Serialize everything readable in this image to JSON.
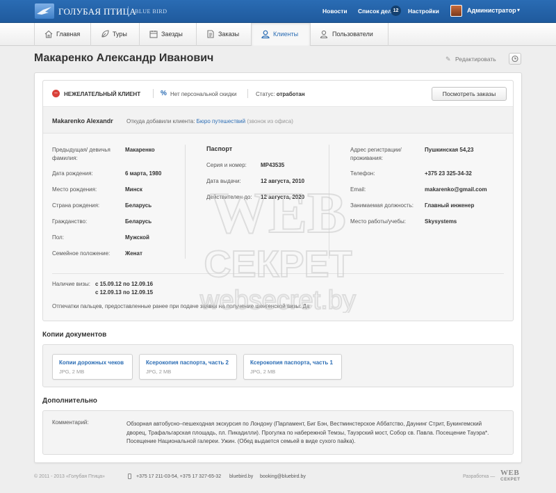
{
  "header": {
    "logo_title": "ГОЛУБАЯ ПТИЦА",
    "logo_sub": "BLUE BIRD",
    "links": [
      "Новости",
      "Список дел",
      "Настройки"
    ],
    "todo_count": "12",
    "user_name": "Администратор",
    "user_caret": "▾"
  },
  "nav": {
    "tabs": [
      {
        "label": "Главная",
        "icon": "home-icon"
      },
      {
        "label": "Туры",
        "icon": "leaf-icon"
      },
      {
        "label": "Заезды",
        "icon": "calendar-icon"
      },
      {
        "label": "Заказы",
        "icon": "document-icon"
      },
      {
        "label": "Клиенты",
        "icon": "user-icon",
        "active": true
      },
      {
        "label": "Пользователи",
        "icon": "users-icon"
      }
    ]
  },
  "page": {
    "title": "Макаренко Александр Иванович",
    "edit_label": "Редактировать"
  },
  "client": {
    "bad_client_label": "НЕЖЕЛАТЕЛЬНЫЙ КЛИЕНТ",
    "discount_label": "Нет персональной скидки",
    "status_label": "Статус:",
    "status_value": "отработан",
    "orders_button": "Посмотреть заказы",
    "latin_name": "Makarenko Alexandr",
    "source_label": "Откуда добавили клиента:",
    "source_value": "Бюро путешествий",
    "source_note": "(звонок из офиса)"
  },
  "personal": {
    "maiden_label": "Предыдущая/ девичья фамилия:",
    "maiden_value": "Макаренко",
    "birth_date_label": "Дата рождения:",
    "birth_date_value": "6 марта, 1980",
    "birth_place_label": "Место рождения:",
    "birth_place_value": "Минск",
    "birth_country_label": "Страна рождения:",
    "birth_country_value": "Беларусь",
    "citizenship_label": "Гражданство:",
    "citizenship_value": "Беларусь",
    "sex_label": "Пол:",
    "sex_value": "Мужской",
    "family_label": "Семейное положение:",
    "family_value": "Женат"
  },
  "passport": {
    "title": "Паспорт",
    "number_label": "Серия и номер:",
    "number_value": "MP43535",
    "issue_label": "Дата выдачи:",
    "issue_value": "12 августа, 2010",
    "valid_label": "Действителен до:",
    "valid_value": "12 августа, 2020"
  },
  "contacts": {
    "address_label": "Адрес регистрации/ проживания:",
    "address_value": "Пушкинская 54,23",
    "phone_label": "Телефон:",
    "phone_value": "+375 23 325-34-32",
    "email_label": "Email:",
    "email_value": "makarenko@gmail.com",
    "position_label": "Занимаемая должность:",
    "position_value": "Главный инженер",
    "work_label": "Место работы/учебы:",
    "work_value": "Skysystems"
  },
  "visa": {
    "label": "Наличие визы:",
    "entries": [
      "с 15.09.12 по 12.09.16",
      "с 12.09.13 по 12.09.15"
    ],
    "fingerprints": "Отпечатки пальцев, предоставленные ранее при подаче заявки на получение шенгенской визы: Да"
  },
  "documents": {
    "title": "Копии документов",
    "items": [
      {
        "title": "Копии дорожных чеков",
        "meta": "JPG, 2 MB"
      },
      {
        "title": "Ксерокопия паспорта, часть 2",
        "meta": "JPG, 2 MB"
      },
      {
        "title": "Ксерокопия паспорта, часть 1",
        "meta": "JPG, 2 MB"
      }
    ]
  },
  "extra": {
    "title": "Дополнительно",
    "comment_label": "Комментарий:",
    "comment_text": "Обзорная автобусно–пешеходная экскурсия по Лондону (Парламент, Биг Бэн, Вестминстерское Аббатство, Даунинг Стрит, Букингемский дворец, Трафальгарская площадь, пл. Пикадилли). Прогулка по набережной Темзы, Тауэрский мост, Собор св. Павла. Посещение Тауэра*. Посещение  Национальной галереи. Ужин. (Обед выдается семьей в виде сухого пайка)."
  },
  "footer": {
    "copyright": "© 2011 - 2013 «Голубая Птица»",
    "phones": "+375 17 211-03-54, +375 17 327-65-32",
    "site": "bluebird.by",
    "email": "booking@bluebird.by",
    "dev_label": "Разработка —",
    "dev_logo_top": "WEB",
    "dev_logo_bottom": "СЕКРЕТ"
  },
  "watermark": {
    "line1": "WEB",
    "line2": "СЕКРЕТ",
    "line3": "websecret.by"
  },
  "colors": {
    "brand_blue": "#2a6cb4",
    "warning_red": "#d9413a"
  }
}
